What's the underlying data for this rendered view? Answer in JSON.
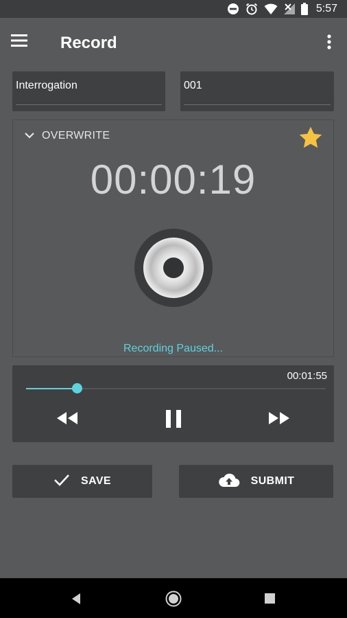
{
  "status_bar": {
    "time": "5:57",
    "icons": [
      "do-not-disturb-icon",
      "alarm-icon",
      "wifi-icon",
      "no-signal-icon",
      "battery-icon"
    ]
  },
  "app_bar": {
    "title": "Record",
    "icons": [
      "menu-icon",
      "more-vert-icon"
    ]
  },
  "fields": {
    "name": {
      "value": "Interrogation"
    },
    "number": {
      "value": "001"
    }
  },
  "record_panel": {
    "mode_label": "OVERWRITE",
    "timer": "00:00:19",
    "status": "Recording Paused...",
    "starred": true,
    "icons": [
      "chevron-down-icon",
      "star-icon",
      "record-disc-icon"
    ]
  },
  "player": {
    "duration": "00:01:55",
    "progress_fraction": 0.17,
    "controls": [
      "rewind-icon",
      "pause-icon",
      "fast-forward-icon"
    ]
  },
  "actions": {
    "save_label": "SAVE",
    "submit_label": "SUBMIT",
    "icons": [
      "check-icon",
      "cloud-upload-icon"
    ]
  },
  "colors": {
    "background": "#58595b",
    "card": "#3f4042",
    "accent": "#5fd3dd",
    "star": "#f5c242",
    "status_bar": "#3c3d3f",
    "nav_bar": "#000000"
  }
}
